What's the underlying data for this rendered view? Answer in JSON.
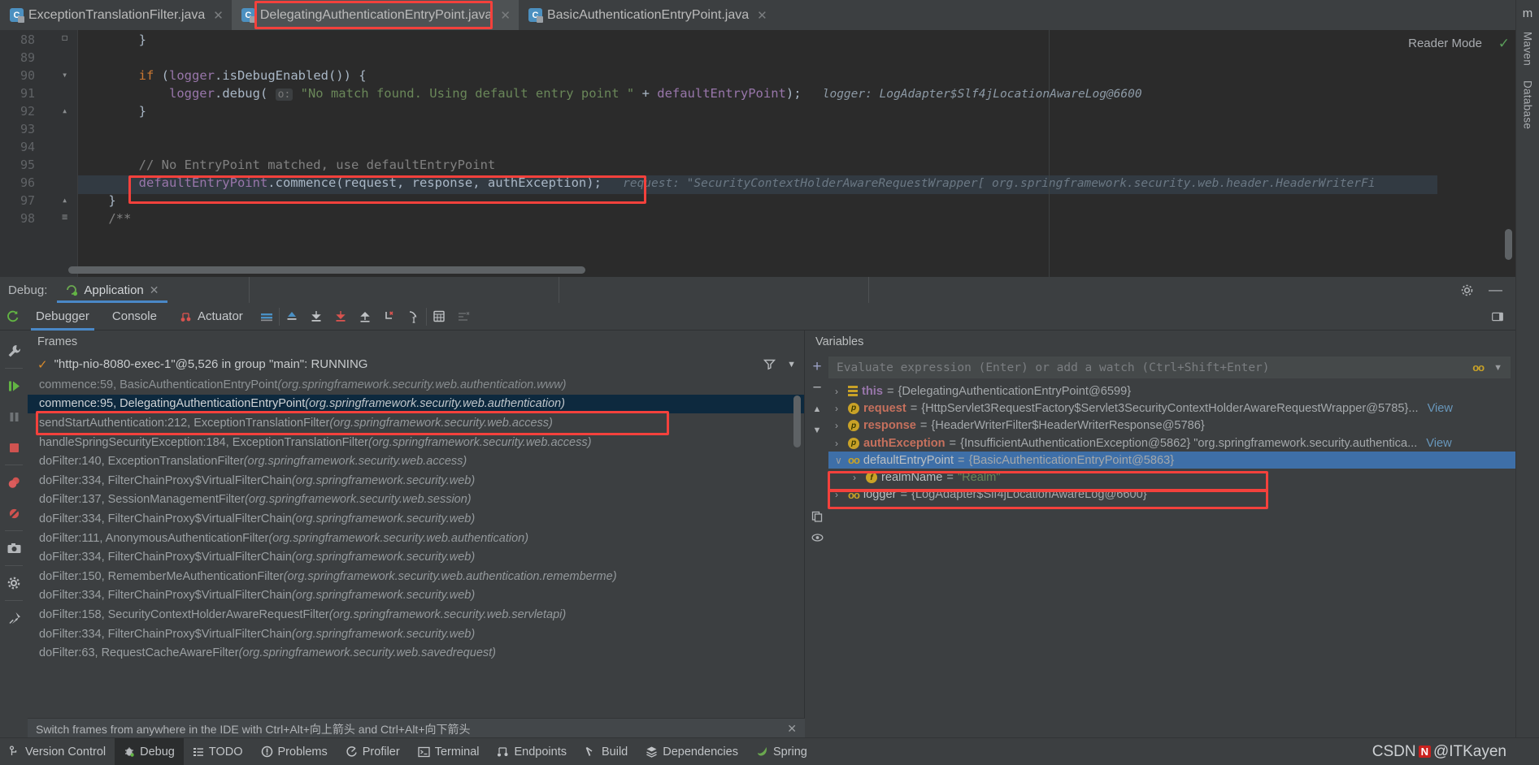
{
  "editor_tabs": [
    {
      "label": "ExceptionTranslationFilter.java",
      "icon": "java-class-icon",
      "active": false,
      "closable": true
    },
    {
      "label": "DelegatingAuthenticationEntryPoint.java",
      "icon": "java-class-icon",
      "active": true,
      "closable": true,
      "highlighted": true
    },
    {
      "label": "BasicAuthenticationEntryPoint.java",
      "icon": "java-class-icon",
      "active": false,
      "closable": true
    }
  ],
  "editor": {
    "reader_mode": "Reader Mode",
    "inspection_status_icon": "checkmark-icon",
    "more_icon": "vertical-ellipsis-icon",
    "lines": [
      {
        "num": "88",
        "fold": "┐",
        "tokens": [
          {
            "t": "plain",
            "s": "        }"
          }
        ]
      },
      {
        "num": "89",
        "fold": "",
        "tokens": []
      },
      {
        "num": "90",
        "fold": "▽",
        "tokens": [
          {
            "t": "kw",
            "s": "        if "
          },
          {
            "t": "plain",
            "s": "("
          },
          {
            "t": "fld",
            "s": "logger"
          },
          {
            "t": "plain",
            "s": ".isDebugEnabled()) {"
          }
        ]
      },
      {
        "num": "91",
        "fold": "",
        "tokens": [
          {
            "t": "plain",
            "s": "            "
          },
          {
            "t": "fld",
            "s": "logger"
          },
          {
            "t": "plain",
            "s": ".debug( "
          },
          {
            "t": "hint",
            "s": "o:"
          },
          {
            "t": "str",
            "s": " \"No match found. Using default entry point \" "
          },
          {
            "t": "plain",
            "s": "+ "
          },
          {
            "t": "fld",
            "s": "defaultEntryPoint"
          },
          {
            "t": "plain",
            "s": ");"
          }
        ],
        "inline": "logger: LogAdapter$Slf4jLocationAwareLog@6600"
      },
      {
        "num": "92",
        "fold": "△",
        "tokens": [
          {
            "t": "plain",
            "s": "        }"
          }
        ]
      },
      {
        "num": "93",
        "fold": "",
        "tokens": []
      },
      {
        "num": "94",
        "fold": "",
        "tokens": [
          {
            "t": "cmt",
            "s": "        // No EntryPoint matched, use defaultEntryPoint"
          }
        ]
      },
      {
        "num": "95",
        "fold": "",
        "highlighted": true,
        "current": true,
        "tokens": [
          {
            "t": "fld",
            "s": "        defaultEntryPoint"
          },
          {
            "t": "plain",
            "s": "."
          },
          {
            "t": "mth2",
            "s": "commence"
          },
          {
            "t": "plain",
            "s": "(request, response, authException);"
          }
        ],
        "inline": "request: \"SecurityContextHolderAwareRequestWrapper[ org.springframework.security.web.header.HeaderWriterFi"
      },
      {
        "num": "96",
        "fold": "△",
        "tokens": [
          {
            "t": "plain",
            "s": "    }"
          }
        ]
      },
      {
        "num": "97",
        "fold": "",
        "tokens": []
      },
      {
        "num": "98",
        "fold": "≡",
        "tokens": [
          {
            "t": "cmt",
            "s": "    /**"
          }
        ]
      }
    ]
  },
  "right_sidebar": [
    {
      "label": "Maven",
      "icon": "maven-icon"
    },
    {
      "label": "Database",
      "icon": "database-icon"
    }
  ],
  "debug_window": {
    "label": "Debug:",
    "tab": {
      "label": "Application",
      "icon": "spring-boot-run-icon",
      "close_icon": "close-icon"
    },
    "settings_icon": "gear-icon",
    "minimize_icon": "minimize-icon",
    "toolbar": {
      "rerun_icon": "rerun-icon",
      "tabs": [
        {
          "label": "Debugger",
          "active": true
        },
        {
          "label": "Console",
          "active": false
        },
        {
          "label": "Actuator",
          "active": false,
          "icon": "actuator-icon"
        }
      ],
      "icons": [
        "layout-icon",
        "show-execution-point-icon",
        "step-over-icon",
        "step-into-icon",
        "step-out-icon",
        "force-step-into-icon",
        "run-to-cursor-icon",
        "evaluate-expression-icon",
        "mute-breakpoints-icon"
      ],
      "right_icon": "restore-layout-icon"
    }
  },
  "left_strip_icons": [
    "settings-wrench-icon",
    "resume-program-icon",
    "pause-program-icon",
    "stop-icon",
    "view-breakpoints-icon",
    "mute-breakpoints-icon",
    "screenshot-icon",
    "settings-gear-icon",
    "pin-tab-icon"
  ],
  "frames_panel": {
    "title": "Frames",
    "thread": "\"http-nio-8080-exec-1\"@5,526 in group \"main\": RUNNING",
    "thread_icon": "checkmark-icon",
    "filter_icon": "filter-icon",
    "dropdown_icon": "chevron-down-icon",
    "rows": [
      {
        "method": "commence:59, BasicAuthenticationEntryPoint",
        "pkg": "(org.springframework.security.web.authentication.www)",
        "selected": false,
        "dim": true
      },
      {
        "method": "commence:95, DelegatingAuthenticationEntryPoint",
        "pkg": "(org.springframework.security.web.authentication)",
        "selected": true,
        "highlighted": true
      },
      {
        "method": "sendStartAuthentication:212, ExceptionTranslationFilter",
        "pkg": "(org.springframework.security.web.access)",
        "selected": false
      },
      {
        "method": "handleSpringSecurityException:184, ExceptionTranslationFilter",
        "pkg": "(org.springframework.security.web.access)",
        "selected": false
      },
      {
        "method": "doFilter:140, ExceptionTranslationFilter",
        "pkg": "(org.springframework.security.web.access)",
        "selected": false
      },
      {
        "method": "doFilter:334, FilterChainProxy$VirtualFilterChain",
        "pkg": "(org.springframework.security.web)",
        "selected": false
      },
      {
        "method": "doFilter:137, SessionManagementFilter",
        "pkg": "(org.springframework.security.web.session)",
        "selected": false
      },
      {
        "method": "doFilter:334, FilterChainProxy$VirtualFilterChain",
        "pkg": "(org.springframework.security.web)",
        "selected": false
      },
      {
        "method": "doFilter:111, AnonymousAuthenticationFilter",
        "pkg": "(org.springframework.security.web.authentication)",
        "selected": false
      },
      {
        "method": "doFilter:334, FilterChainProxy$VirtualFilterChain",
        "pkg": "(org.springframework.security.web)",
        "selected": false
      },
      {
        "method": "doFilter:150, RememberMeAuthenticationFilter",
        "pkg": "(org.springframework.security.web.authentication.rememberme)",
        "selected": false
      },
      {
        "method": "doFilter:334, FilterChainProxy$VirtualFilterChain",
        "pkg": "(org.springframework.security.web)",
        "selected": false
      },
      {
        "method": "doFilter:158, SecurityContextHolderAwareRequestFilter",
        "pkg": "(org.springframework.security.web.servletapi)",
        "selected": false
      },
      {
        "method": "doFilter:334, FilterChainProxy$VirtualFilterChain",
        "pkg": "(org.springframework.security.web)",
        "selected": false
      },
      {
        "method": "doFilter:63, RequestCacheAwareFilter",
        "pkg": "(org.springframework.security.web.savedrequest)",
        "selected": false
      }
    ]
  },
  "variables_panel": {
    "title": "Variables",
    "evaluate_placeholder": "Evaluate expression (Enter) or add a watch (Ctrl+Shift+Enter)",
    "eval_icons": [
      "object-icon",
      "chevron-down-icon"
    ],
    "strip_icons": [
      "add-watch-icon",
      "remove-watch-icon",
      "up-icon",
      "down-icon",
      "copy-icon",
      "eye-icon"
    ],
    "rows": [
      {
        "arrow": "›",
        "badge": "this",
        "name": "this",
        "eq": " = ",
        "value": "{DelegatingAuthenticationEntryPoint@6599}",
        "indent": 0,
        "selected": false
      },
      {
        "arrow": "›",
        "badge": "p",
        "name": "request",
        "eq": " = ",
        "value": "{HttpServlet3RequestFactory$Servlet3SecurityContextHolderAwareRequestWrapper@5785}...",
        "link": "View",
        "indent": 0,
        "selected": false
      },
      {
        "arrow": "›",
        "badge": "p",
        "name": "response",
        "eq": " = ",
        "value": "{HeaderWriterFilter$HeaderWriterResponse@5786}",
        "indent": 0,
        "selected": false
      },
      {
        "arrow": "›",
        "badge": "p",
        "name": "authException",
        "eq": " = ",
        "value": "{InsufficientAuthenticationException@5862} \"org.springframework.security.authentica...",
        "link": "View",
        "indent": 0,
        "selected": false
      },
      {
        "arrow": "∨",
        "badge": "oo",
        "name": "defaultEntryPoint",
        "eq": " = ",
        "value": "{BasicAuthenticationEntryPoint@5863}",
        "indent": 0,
        "selected": true,
        "highlighted": true
      },
      {
        "arrow": "›",
        "badge": "f",
        "name": "realmName",
        "eq": " = ",
        "value": "\"Realm\"",
        "value_is_string": true,
        "indent": 1,
        "selected": false,
        "highlighted": true
      },
      {
        "arrow": "›",
        "badge": "oo",
        "name": "logger",
        "eq": " = ",
        "value": "{LogAdapter$Slf4jLocationAwareLog@6600}",
        "indent": 0,
        "selected": false
      }
    ]
  },
  "hint_bar": {
    "text": "Switch frames from anywhere in the IDE with Ctrl+Alt+向上箭头 and Ctrl+Alt+向下箭头",
    "close_icon": "close-icon"
  },
  "status_bar": {
    "items": [
      {
        "label": "Version Control",
        "icon": "branch-icon",
        "active": false
      },
      {
        "label": "Debug",
        "icon": "debug-icon",
        "active": true
      },
      {
        "label": "TODO",
        "icon": "todo-icon",
        "active": false
      },
      {
        "label": "Problems",
        "icon": "problems-icon",
        "active": false
      },
      {
        "label": "Profiler",
        "icon": "profiler-icon",
        "active": false
      },
      {
        "label": "Terminal",
        "icon": "terminal-icon",
        "active": false
      },
      {
        "label": "Endpoints",
        "icon": "endpoints-icon",
        "active": false
      },
      {
        "label": "Build",
        "icon": "build-icon",
        "active": false
      },
      {
        "label": "Dependencies",
        "icon": "dependencies-icon",
        "active": false
      },
      {
        "label": "Spring",
        "icon": "spring-icon",
        "active": false
      }
    ],
    "watermark": {
      "prefix": "CSDN",
      "badge": "N",
      "handle": "@ITKayen"
    }
  },
  "colors": {
    "highlight_red": "#f4413c",
    "selection_blue": "#3e6fa8",
    "frame_selected": "#0d293e",
    "accent_tab": "#4a88c7",
    "editor_bg": "#2b2b2b",
    "panel_bg": "#3c3f41"
  }
}
